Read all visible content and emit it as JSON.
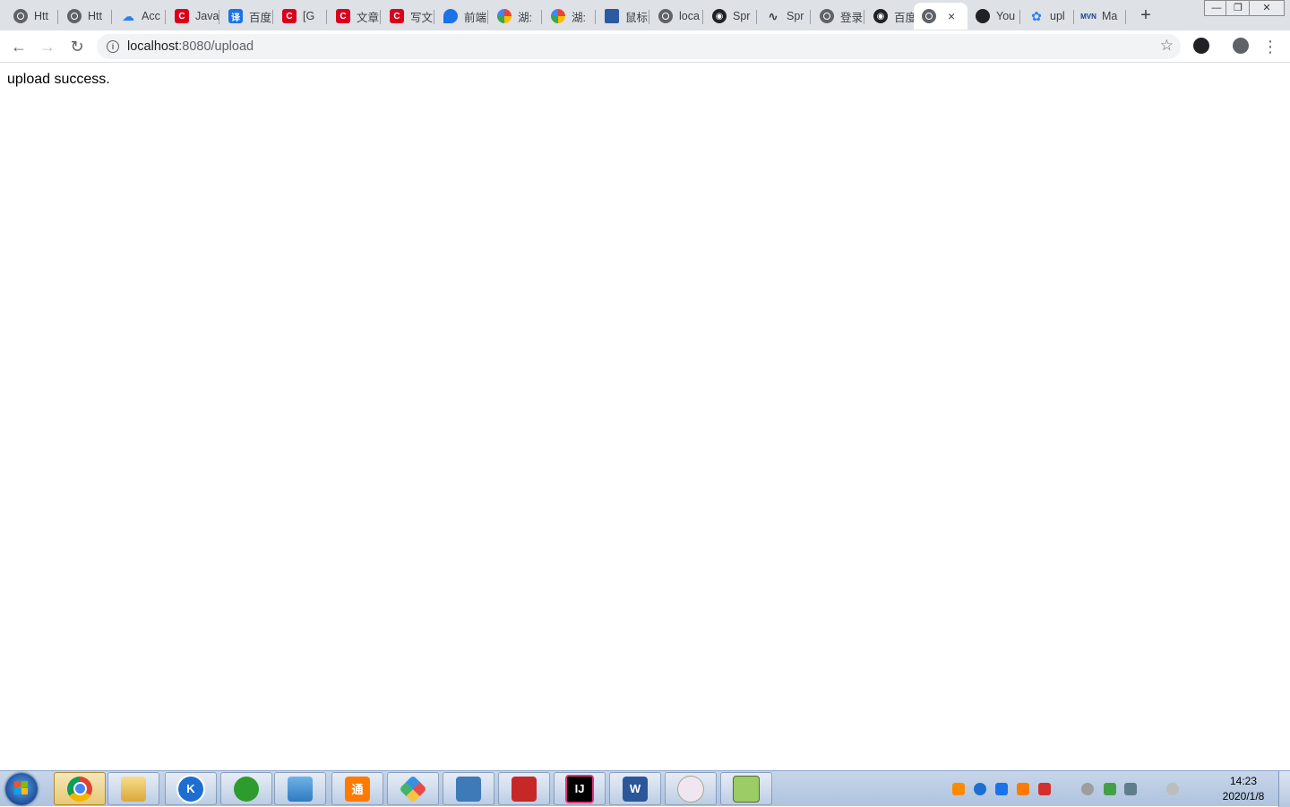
{
  "browser": {
    "tabs": [
      {
        "title": "Htt",
        "icon": "globe-icon"
      },
      {
        "title": "Htt",
        "icon": "globe-icon"
      },
      {
        "title": "Acc",
        "icon": "cloud-icon"
      },
      {
        "title": "Java",
        "icon": "csdn-icon"
      },
      {
        "title": "百度",
        "icon": "translate-icon"
      },
      {
        "title": "[G",
        "icon": "csdn-icon"
      },
      {
        "title": "文章",
        "icon": "csdn-icon"
      },
      {
        "title": "写文",
        "icon": "csdn-icon"
      },
      {
        "title": "前端",
        "icon": "pin-icon"
      },
      {
        "title": "湖:",
        "icon": "google-icon"
      },
      {
        "title": "湖:",
        "icon": "google-icon"
      },
      {
        "title": "鼠标",
        "icon": "monitor-icon"
      },
      {
        "title": "loca",
        "icon": "globe-icon"
      },
      {
        "title": "Spr",
        "icon": "extension-icon"
      },
      {
        "title": "Spr",
        "icon": "feather-icon"
      },
      {
        "title": "登录",
        "icon": "globe-icon"
      },
      {
        "title": "百度",
        "icon": "extension-icon"
      },
      {
        "title": "",
        "icon": "globe-icon",
        "active": true
      },
      {
        "title": "You",
        "icon": "github-icon"
      },
      {
        "title": "upl",
        "icon": "paw-icon"
      },
      {
        "title": "Ma",
        "icon": "mvn-icon"
      }
    ],
    "active_close": "×",
    "new_tab": "+",
    "window_controls": {
      "minimize": "—",
      "restore": "❐",
      "close": "✕"
    }
  },
  "toolbar": {
    "back": "←",
    "forward": "→",
    "reload": "↻",
    "url_host": "localhost",
    "url_rest": ":8080/upload",
    "star": "☆",
    "menu": "⋮"
  },
  "page": {
    "message": "upload success."
  },
  "taskbar": {
    "apps": [
      "chrome",
      "file-explorer",
      "kuaiya",
      "wechat-like",
      "image-viewer",
      "tongji",
      "git",
      "remote-desktop",
      "toolbox",
      "intellij-idea",
      "word",
      "app-circle",
      "notepad-plus"
    ],
    "time": "14:23",
    "date": "2020/1/8"
  }
}
